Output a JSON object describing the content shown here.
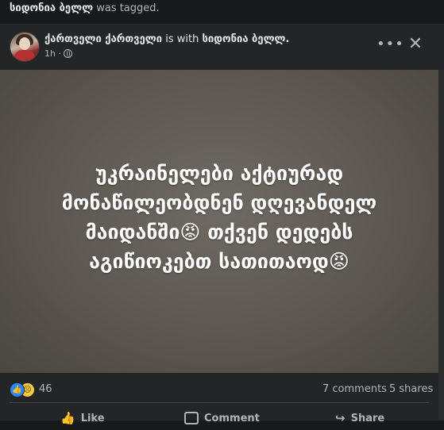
{
  "tag_line": {
    "name": "სიდონია ბელლ",
    "rest": " was tagged."
  },
  "post": {
    "author": "ქართველი ქართველი",
    "with_text": " is with ",
    "tagged": "სიდონია ბელლ.",
    "time": "1h ·",
    "menu_icon": "more-horizontal-icon",
    "close_icon": "close-icon",
    "image_text": "უკრაინელები აქტიურად მონაწილეობდნენ დღევანდელ მაიდანში😡 თქვენ დედებს აგიწიოკებთ სათითაოდ😡"
  },
  "stats": {
    "reactions": "46",
    "comments": "7 comments",
    "shares": "5 shares"
  },
  "actions": {
    "like": "Like",
    "comment": "Comment",
    "share": "Share"
  },
  "colors": {
    "background": "#18191a",
    "card": "#242526",
    "text": "#e4e6eb",
    "muted": "#b0b3b8",
    "like_blue": "#2d88ff"
  }
}
